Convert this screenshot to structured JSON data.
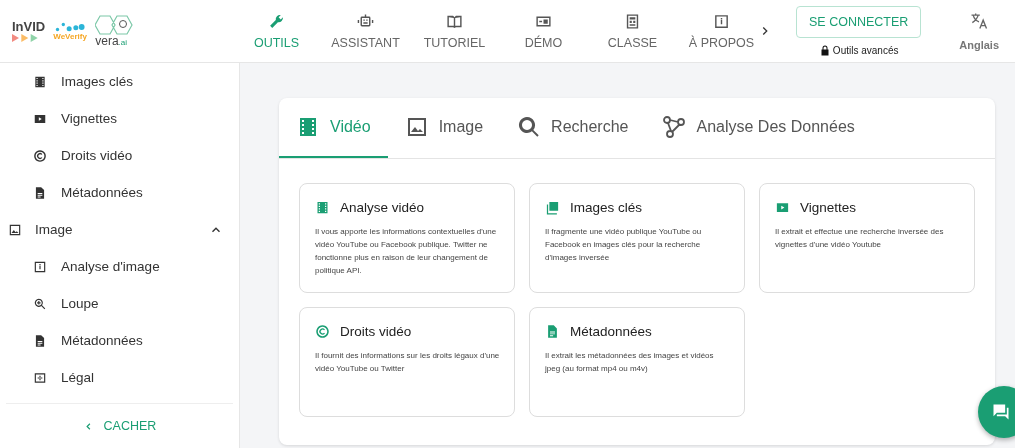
{
  "logos": {
    "invid": "InVID",
    "weverify": "WeVerify",
    "vera": "vera",
    "vera_suffix": ".ai"
  },
  "nav": [
    {
      "label": "OUTILS",
      "selected": true
    },
    {
      "label": "ASSISTANT",
      "selected": false
    },
    {
      "label": "TUTORIEL",
      "selected": false
    },
    {
      "label": "DÉMO",
      "selected": false
    },
    {
      "label": "CLASSE",
      "selected": false
    },
    {
      "label": "À PROPOS",
      "selected": false
    }
  ],
  "login_button": "SE CONNECTER",
  "advanced_tools": "Outils avancés",
  "language": "Anglais",
  "sidebar": {
    "items": [
      {
        "kind": "item",
        "label": "Images clés"
      },
      {
        "kind": "item",
        "label": "Vignettes"
      },
      {
        "kind": "item",
        "label": "Droits vidéo"
      },
      {
        "kind": "item",
        "label": "Métadonnées"
      },
      {
        "kind": "section",
        "label": "Image",
        "expanded": true
      },
      {
        "kind": "item",
        "label": "Analyse d'image"
      },
      {
        "kind": "item",
        "label": "Loupe"
      },
      {
        "kind": "item",
        "label": "Métadonnées"
      },
      {
        "kind": "item",
        "label": "Légal"
      }
    ],
    "hide_button": "CACHER"
  },
  "tabs": [
    {
      "label": "Vidéo",
      "selected": true
    },
    {
      "label": "Image",
      "selected": false
    },
    {
      "label": "Recherche",
      "selected": false
    },
    {
      "label": "Analyse Des Données",
      "selected": false
    }
  ],
  "tools": [
    {
      "title": "Analyse vidéo",
      "description": "Il vous apporte les informations contextuelles d'une vidéo YouTube ou Facebook publique. Twitter ne fonctionne plus en raison de leur changement de politique API."
    },
    {
      "title": "Images clés",
      "description": "Il fragmente une vidéo publique YouTube ou Facebook en images clés pour la recherche d'images inversée"
    },
    {
      "title": "Vignettes",
      "description": "Il extrait et effectue une recherche inversée des vignettes d'une vidéo Youtube"
    },
    {
      "title": "Droits vidéo",
      "description": "Il fournit des informations sur les droits légaux d'une vidéo YouTube ou Twitter"
    },
    {
      "title": "Métadonnées",
      "description": "Il extrait les métadonnées des images et vidéos jpeg (au format mp4 ou m4v)"
    }
  ]
}
